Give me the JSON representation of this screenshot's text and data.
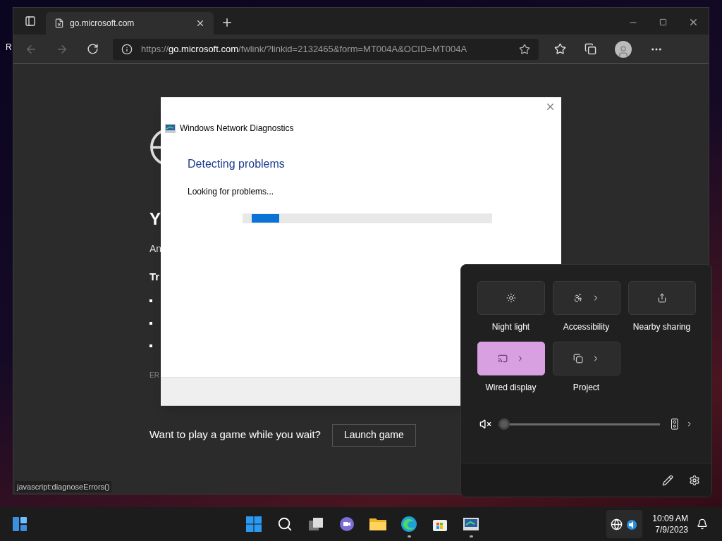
{
  "desktop": {
    "icon_labels": [
      "R"
    ]
  },
  "browser": {
    "tabs": [
      {
        "label": "go.microsoft.com",
        "selected": true
      }
    ],
    "address": {
      "scheme": "https://",
      "host": "go.microsoft.com",
      "path": "/fwlink/?linkid=2132465&form=MT004A&OCID=MT004A"
    },
    "page": {
      "heading": "Y",
      "intro": "An",
      "try_heading": "Tr",
      "error_code": "ER",
      "game_prompt": "Want to play a game while you wait?",
      "game_button": "Launch game"
    },
    "status_text": "javascript:diagnoseErrors()"
  },
  "dialog": {
    "title": "Windows Network Diagnostics",
    "heading": "Detecting problems",
    "message": "Looking for problems...",
    "progress": {
      "level": 0.11
    }
  },
  "quick_settings": {
    "tiles": [
      {
        "kind": "night_light",
        "label": "Night light",
        "on": false,
        "has_menu": false
      },
      {
        "kind": "accessibility",
        "label": "Accessibility",
        "on": false,
        "has_menu": true
      },
      {
        "kind": "nearby_sharing",
        "label": "Nearby sharing",
        "on": false,
        "has_menu": false
      },
      {
        "kind": "cast",
        "label": "Wired display",
        "on": true,
        "has_menu": true
      },
      {
        "kind": "project",
        "label": "Project",
        "on": false,
        "has_menu": true
      }
    ],
    "volume": {
      "muted": true,
      "level": 0
    }
  },
  "taskbar": {
    "apps": [
      {
        "kind": "start",
        "running": false
      },
      {
        "kind": "search",
        "running": false
      },
      {
        "kind": "task_view",
        "running": false
      },
      {
        "kind": "chat",
        "running": false
      },
      {
        "kind": "explorer",
        "running": false
      },
      {
        "kind": "edge",
        "running": true
      },
      {
        "kind": "store",
        "running": false
      },
      {
        "kind": "net_diag",
        "running": true
      }
    ],
    "time": "10:09 AM",
    "date": "7/9/2023"
  }
}
